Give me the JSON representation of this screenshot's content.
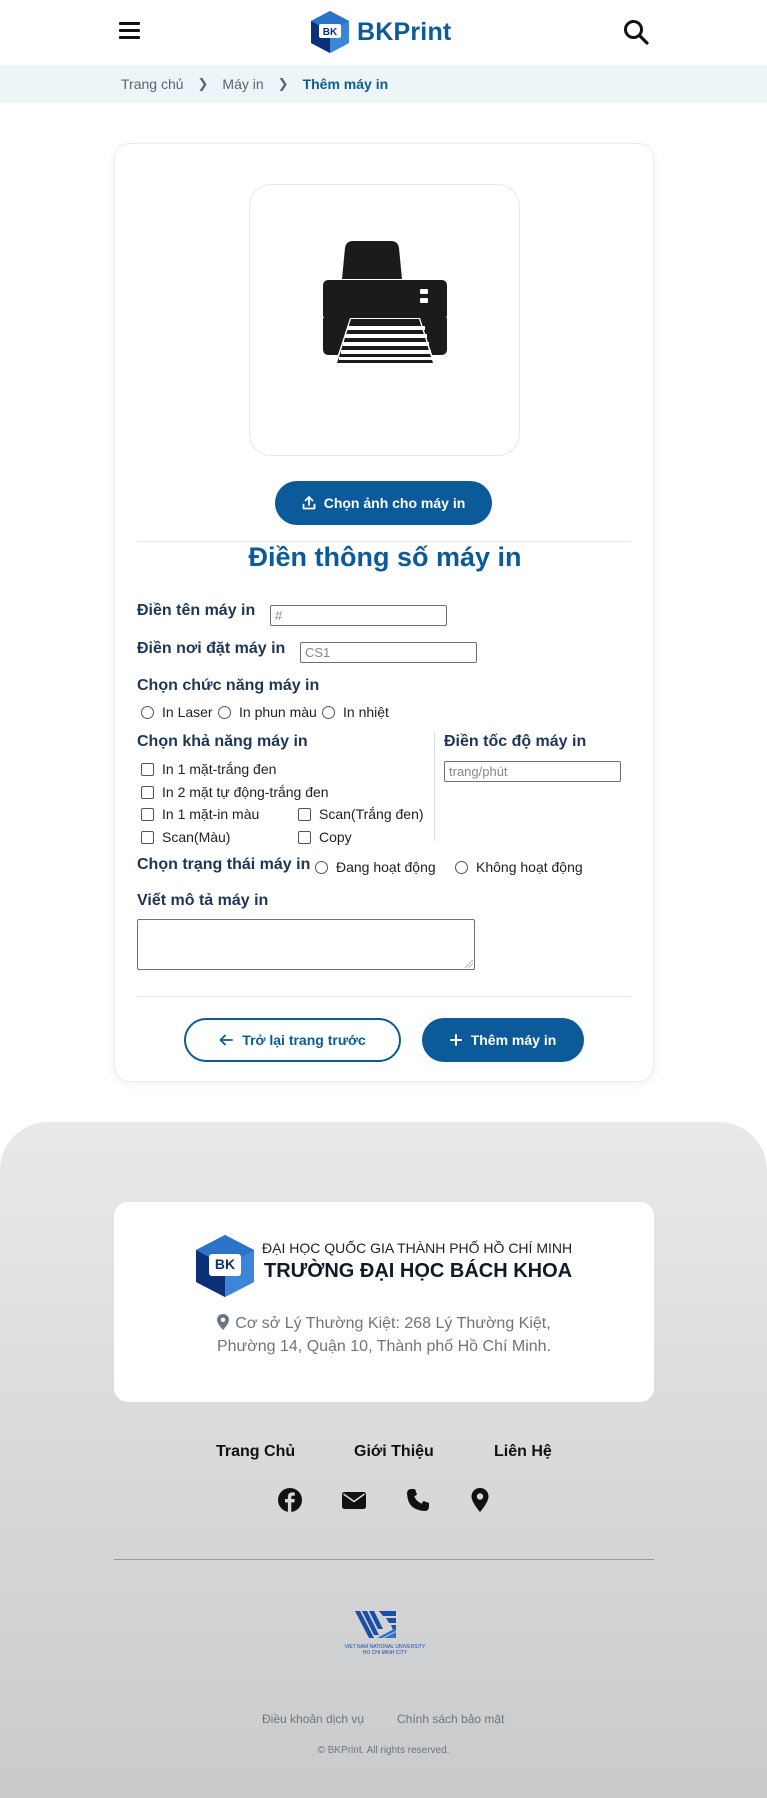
{
  "header": {
    "brand": "BKPrint",
    "menu_icon": "hamburger-icon",
    "search_icon": "search-icon",
    "accent": "#0b5a99"
  },
  "breadcrumb": {
    "items": [
      "Trang chủ",
      "Máy in",
      "Thêm máy in"
    ]
  },
  "image_section": {
    "upload_label": "Chọn ảnh cho máy in"
  },
  "form": {
    "title": "Điền thông số máy in",
    "name_label": "Điền tên máy in",
    "name_placeholder": "#",
    "location_label": "Điền nơi đặt máy in",
    "location_placeholder": "CS1",
    "function_label": "Chọn chức năng máy in",
    "functions": [
      "In Laser",
      "In phun màu",
      "In nhiệt"
    ],
    "capability_label": "Chọn khả năng máy in",
    "capabilities": [
      "In 1 mặt-trắng đen",
      "In 2 mặt tự động-trắng đen",
      "In 1 mặt-in màu",
      "Scan(Trắng đen)",
      "Scan(Màu)",
      "Copy"
    ],
    "speed_label": "Điền tốc độ máy in",
    "speed_placeholder": "trang/phút",
    "status_label": "Chọn trạng thái máy in",
    "statuses": [
      "Đang hoạt động",
      "Không hoạt động"
    ],
    "description_label": "Viết mô tả máy in",
    "back_label": "Trở lại trang trước",
    "submit_label": "Thêm máy in"
  },
  "footer": {
    "university_parent": "ĐẠI HỌC QUỐC GIA THÀNH PHỐ HỒ CHÍ MINH",
    "university_name": "TRƯỜNG ĐẠI HỌC BÁCH KHOA",
    "address_line1": "Cơ sở Lý Thường Kiệt: 268 Lý Thường Kiệt,",
    "address_line2": "Phường 14, Quận 10, Thành phố Hồ Chí Minh.",
    "links": [
      "Trang Chủ",
      "Giới Thiệu",
      "Liên Hệ"
    ],
    "social_icons": [
      "facebook-icon",
      "mail-icon",
      "phone-icon",
      "location-icon"
    ],
    "vnu_logo_text1": "VIET NAM NATIONAL UNIVERSITY",
    "vnu_logo_text2": "HO CHI MINH CITY",
    "terms": "Điều khoản dịch vụ",
    "privacy": "Chính sách bảo mật",
    "copyright": "© BKPrint. All rights reserved."
  }
}
